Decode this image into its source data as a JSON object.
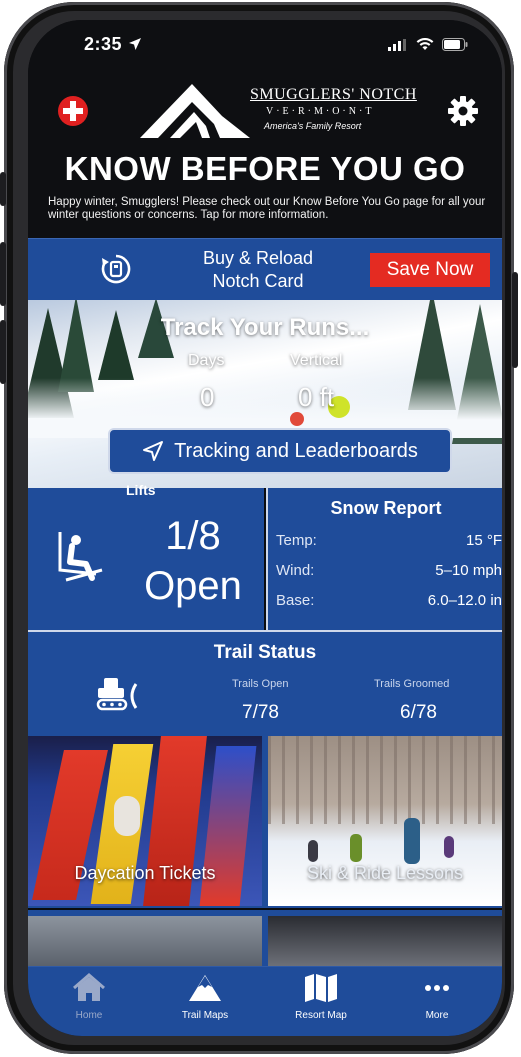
{
  "status_bar": {
    "time": "2:35"
  },
  "header": {
    "brand_name": "SMUGGLERS' NOTCH",
    "brand_sub": "V·E·R·M·O·N·T",
    "brand_tagline": "America's Family Resort"
  },
  "banner": {
    "title": "KNOW BEFORE YOU GO",
    "text": "Happy winter, Smugglers! Please check out our Know Before You Go page for all your winter questions or concerns.  Tap for more information."
  },
  "notch_card": {
    "label": "Buy & Reload Notch Card",
    "button": "Save Now",
    "button_color": "#e42b22"
  },
  "tracking": {
    "title": "Track Your Runs...",
    "days_label": "Days",
    "days_value": "0",
    "vertical_label": "Vertical",
    "vertical_value": "0 ft",
    "button": "Tracking and Leaderboards"
  },
  "lifts": {
    "label": "Lifts",
    "count": "1/8",
    "status": "Open"
  },
  "snow_report": {
    "title": "Snow Report",
    "rows": [
      {
        "key": "Temp:",
        "value": "15 °F"
      },
      {
        "key": "Wind:",
        "value": "5–10 mph"
      },
      {
        "key": "Base:",
        "value": "6.0–12.0 in"
      }
    ]
  },
  "trail_status": {
    "title": "Trail Status",
    "open_label": "Trails Open",
    "open_value": "7/78",
    "groomed_label": "Trails Groomed",
    "groomed_value": "6/78"
  },
  "tiles": [
    {
      "caption": "Daycation Tickets"
    },
    {
      "caption": "Ski & Ride Lessons"
    }
  ],
  "tab_bar": [
    {
      "label": "Home",
      "icon": "home-icon"
    },
    {
      "label": "Trail Maps",
      "icon": "mountain-icon"
    },
    {
      "label": "Resort Map",
      "icon": "map-icon"
    },
    {
      "label": "More",
      "icon": "more-icon"
    }
  ],
  "colors": {
    "brand_blue": "#1f4c9a",
    "header_black": "#0e0f12",
    "alert_red": "#e42b22"
  }
}
